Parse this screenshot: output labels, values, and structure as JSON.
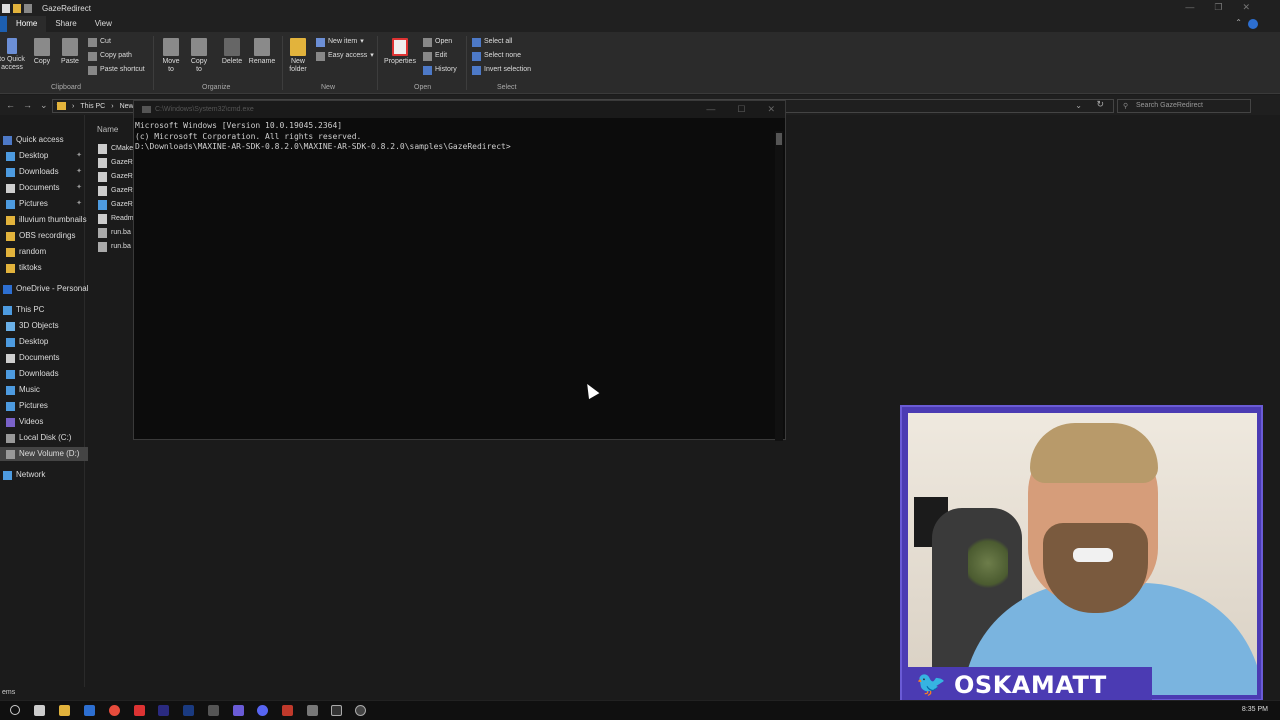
{
  "explorer": {
    "title": "GazeRedirect",
    "tabs": [
      "Home",
      "Share",
      "View"
    ],
    "ribbon": {
      "pin_label": "to Quick access",
      "copy": "Copy",
      "paste": "Paste",
      "cut": "Cut",
      "copy_path": "Copy path",
      "paste_shortcut": "Paste shortcut",
      "move_to": "Move to",
      "copy_to": "Copy to",
      "delete": "Delete",
      "rename": "Rename",
      "new_folder": "New folder",
      "new_item": "New item",
      "easy_access": "Easy access",
      "properties": "Properties",
      "open": "Open",
      "edit": "Edit",
      "history": "History",
      "select_all": "Select all",
      "select_none": "Select none",
      "invert_selection": "Invert selection",
      "groups": [
        "Clipboard",
        "Organize",
        "New",
        "Open",
        "Select"
      ]
    },
    "address": {
      "crumbs": [
        "This PC",
        "New"
      ],
      "search_placeholder": "Search GazeRedirect"
    },
    "nav": {
      "quick_access": "Quick access",
      "quick_items": [
        {
          "label": "Desktop",
          "pinned": true
        },
        {
          "label": "Downloads",
          "pinned": true
        },
        {
          "label": "Documents",
          "pinned": true
        },
        {
          "label": "Pictures",
          "pinned": true
        },
        {
          "label": "illuvium thumbnails",
          "pinned": false
        },
        {
          "label": "OBS recordings",
          "pinned": false
        },
        {
          "label": "random",
          "pinned": false
        },
        {
          "label": "tiktoks",
          "pinned": false
        }
      ],
      "onedrive": "OneDrive - Personal",
      "this_pc": "This PC",
      "pc_items": [
        "3D Objects",
        "Desktop",
        "Documents",
        "Downloads",
        "Music",
        "Pictures",
        "Videos",
        "Local Disk (C:)",
        "New Volume (D:)"
      ],
      "network": "Network"
    },
    "files": {
      "column_name": "Name",
      "rows": [
        "CMake",
        "GazeR",
        "GazeR",
        "GazeR",
        "GazeR",
        "Readm",
        "run.ba",
        "run.ba"
      ]
    },
    "status": "ems"
  },
  "cmd": {
    "title": "C:\\Windows\\System32\\cmd.exe",
    "lines": [
      "Microsoft Windows [Version 10.0.19045.2364]",
      "(c) Microsoft Corporation. All rights reserved.",
      "",
      "D:\\Downloads\\MAXINE-AR-SDK-0.8.2.0\\MAXINE-AR-SDK-0.8.2.0\\samples\\GazeRedirect>"
    ]
  },
  "webcam": {
    "handle": "OSKAMATT",
    "accent": "#4b3bb3"
  },
  "taskbar": {
    "time": "8:35 PM"
  }
}
